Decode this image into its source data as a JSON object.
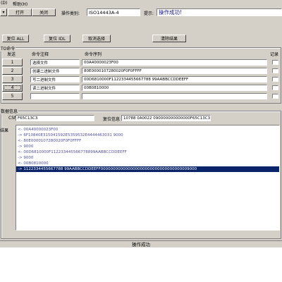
{
  "menu": {
    "items": [
      "(D)",
      "帮助(H)"
    ]
  },
  "toolbar": {
    "open_label": "打开",
    "close_label": "关闭",
    "op_type_label": "操作类别:",
    "op_type_value": "ISO14443A-4",
    "hint_label": "提示:",
    "hint_value": "操作成功!"
  },
  "actions": {
    "reset_all": "复位 ALL",
    "reset_idl": "复位 IDL",
    "cancel_select": "取消选择",
    "clear_results": "清除结果"
  },
  "commands": {
    "group_title": "TO命令",
    "col_send": "发送",
    "col_comment": "命令注释",
    "col_sequence": "命令序列",
    "col_record": "记录",
    "rows": [
      {
        "num": "1",
        "comment": "选择文件",
        "sequence": "00A40000023F00"
      },
      {
        "num": "2",
        "comment": "创建二进制文件",
        "sequence": "80E0000107280020F0F0FFFF"
      },
      {
        "num": "3",
        "comment": "写二进制文件",
        "sequence": "00D6810000F1122334455667788 99AABBCCDDEEFF"
      },
      {
        "num": "4",
        "comment": "读二进制文件",
        "sequence": "00B0810000"
      },
      {
        "num": "5",
        "comment": "",
        "sequence": ""
      }
    ]
  },
  "card": {
    "group_title": "数据信息",
    "csn_label": "CSN",
    "csn_value": "F65C13C3",
    "reset_label": "复位信息",
    "reset_value": "10788 0A0022 090000000000000F65C13C3"
  },
  "results": {
    "label": "结果",
    "lines": [
      "<- 00A40000023F00",
      "-> 6F10840E315041592E5359532E4444463031 9000",
      "<- 80E0000107280020F0F0FFFF",
      "-> 9000",
      "<- 00D6810000F112233445566778899AABBCCDDEEFF",
      "-> 9000",
      "<- 00B0810000",
      "-> 1122334455667788 99AABBCCDDEEFF000000000000000000000000000000000009000"
    ]
  },
  "status": {
    "text": "操作成功"
  }
}
